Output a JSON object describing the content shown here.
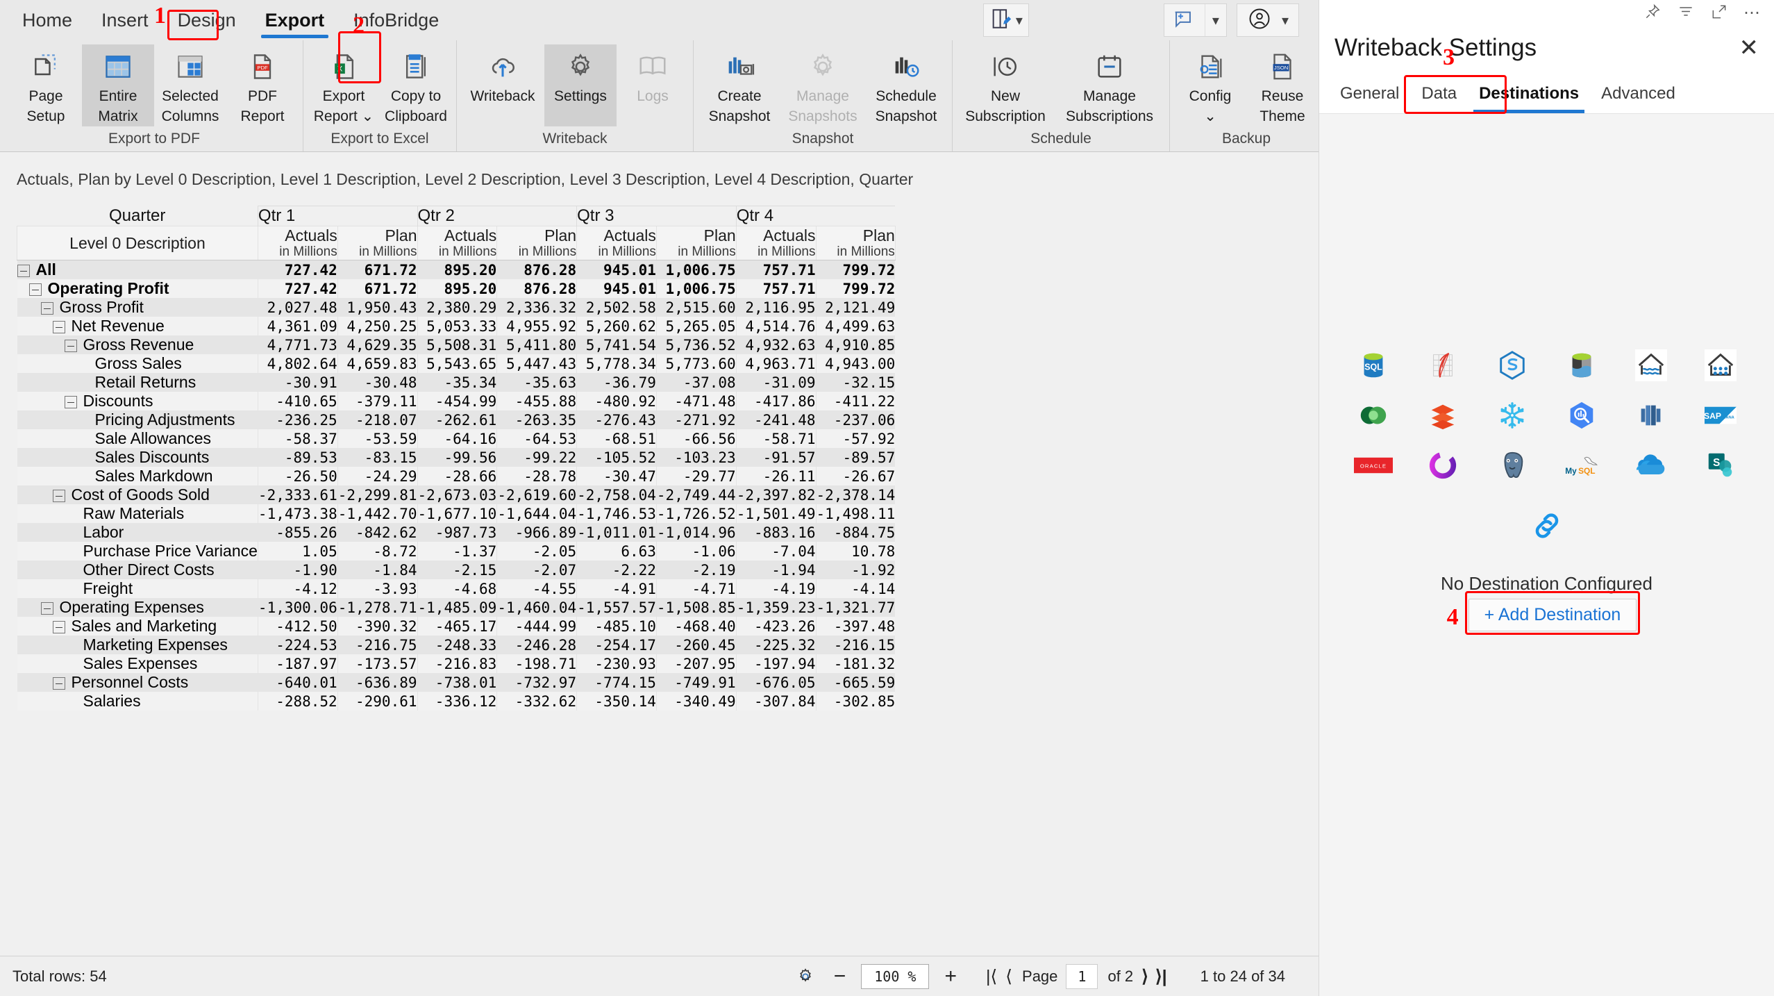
{
  "ribbon": {
    "tabs": [
      {
        "label": "Home",
        "active": false
      },
      {
        "label": "Insert",
        "active": false
      },
      {
        "label": "Design",
        "active": false
      },
      {
        "label": "Export",
        "active": true
      },
      {
        "label": "InfoBridge",
        "active": false
      }
    ],
    "groups": [
      {
        "label": "Export to PDF",
        "items": [
          {
            "label_1": "Page",
            "label_2": "Setup",
            "icon": "page-setup-icon",
            "state": "normal"
          },
          {
            "label_1": "Entire",
            "label_2": "Matrix",
            "icon": "entire-matrix-icon",
            "state": "selected"
          },
          {
            "label_1": "Selected",
            "label_2": "Columns",
            "icon": "selected-columns-icon",
            "state": "normal"
          },
          {
            "label_1": "PDF",
            "label_2": "Report",
            "icon": "pdf-report-icon",
            "state": "normal"
          }
        ]
      },
      {
        "label": "Export to Excel",
        "items": [
          {
            "label_1": "Export",
            "label_2": "Report ⌄",
            "icon": "excel-export-icon",
            "state": "normal"
          },
          {
            "label_1": "Copy to",
            "label_2": "Clipboard",
            "icon": "copy-clipboard-icon",
            "state": "normal"
          }
        ]
      },
      {
        "label": "Writeback",
        "items": [
          {
            "label_1": "Writeback",
            "label_2": "",
            "icon": "writeback-cloud-upload-icon",
            "state": "normal"
          },
          {
            "label_1": "Settings",
            "label_2": "",
            "icon": "gear-icon",
            "state": "selected"
          },
          {
            "label_1": "Logs",
            "label_2": "",
            "icon": "book-icon",
            "state": "disabled"
          }
        ]
      },
      {
        "label": "Snapshot",
        "items": [
          {
            "label_1": "Create",
            "label_2": "Snapshot",
            "icon": "create-snapshot-icon",
            "state": "normal"
          },
          {
            "label_1": "Manage",
            "label_2": "Snapshots",
            "icon": "gear-icon",
            "state": "disabled"
          },
          {
            "label_1": "Schedule",
            "label_2": "Snapshot",
            "icon": "schedule-snapshot-icon",
            "state": "normal"
          }
        ]
      },
      {
        "label": "Schedule",
        "items": [
          {
            "label_1": "New",
            "label_2": "Subscription",
            "icon": "clock-icon",
            "state": "normal"
          },
          {
            "label_1": "Manage",
            "label_2": "Subscriptions",
            "icon": "calendar-icon",
            "state": "normal"
          }
        ]
      },
      {
        "label": "Backup",
        "items": [
          {
            "label_1": "Config",
            "label_2": "⌄",
            "icon": "config-file-gear-icon",
            "state": "normal"
          },
          {
            "label_1": "Reuse",
            "label_2": "Theme",
            "icon": "json-file-icon",
            "state": "normal"
          }
        ]
      }
    ],
    "quick_buttons": [
      {
        "name": "edit-mode-icon",
        "has_caret": true
      },
      {
        "name": "add-comment-icon",
        "has_caret": true
      },
      {
        "name": "account-icon",
        "has_caret": true
      }
    ]
  },
  "annotations": [
    {
      "number": "1",
      "target": "export-tab"
    },
    {
      "number": "2",
      "target": "writeback-settings-button"
    },
    {
      "number": "3",
      "target": "destinations-tab"
    },
    {
      "number": "4",
      "target": "add-destination-button"
    }
  ],
  "report": {
    "subtitle": "Actuals, Plan by Level 0 Description, Level 1 Description, Level 2 Description, Level 3 Description, Level 4 Description, Quarter",
    "corner_label": "Quarter",
    "row_header_label": "Level 0 Description",
    "quarter_groups": [
      "Qtr 1",
      "Qtr 2",
      "Qtr 3",
      "Qtr 4"
    ],
    "measure_headers": [
      {
        "name": "Actuals",
        "unit": "in Millions"
      },
      {
        "name": "Plan",
        "unit": "in Millions"
      }
    ],
    "rows": [
      {
        "label": "All",
        "indent": 0,
        "toggle": true,
        "bold": true,
        "values": [
          "727.42",
          "671.72",
          "895.20",
          "876.28",
          "945.01",
          "1,006.75",
          "757.71",
          "799.72"
        ]
      },
      {
        "label": "Operating Profit",
        "indent": 1,
        "toggle": true,
        "bold": true,
        "values": [
          "727.42",
          "671.72",
          "895.20",
          "876.28",
          "945.01",
          "1,006.75",
          "757.71",
          "799.72"
        ]
      },
      {
        "label": "Gross Profit",
        "indent": 2,
        "toggle": true,
        "bold": false,
        "values": [
          "2,027.48",
          "1,950.43",
          "2,380.29",
          "2,336.32",
          "2,502.58",
          "2,515.60",
          "2,116.95",
          "2,121.49"
        ]
      },
      {
        "label": "Net Revenue",
        "indent": 3,
        "toggle": true,
        "bold": false,
        "values": [
          "4,361.09",
          "4,250.25",
          "5,053.33",
          "4,955.92",
          "5,260.62",
          "5,265.05",
          "4,514.76",
          "4,499.63"
        ]
      },
      {
        "label": "Gross Revenue",
        "indent": 4,
        "toggle": true,
        "bold": false,
        "values": [
          "4,771.73",
          "4,629.35",
          "5,508.31",
          "5,411.80",
          "5,741.54",
          "5,736.52",
          "4,932.63",
          "4,910.85"
        ]
      },
      {
        "label": "Gross Sales",
        "indent": 5,
        "toggle": false,
        "bold": false,
        "values": [
          "4,802.64",
          "4,659.83",
          "5,543.65",
          "5,447.43",
          "5,778.34",
          "5,773.60",
          "4,963.71",
          "4,943.00"
        ]
      },
      {
        "label": "Retail Returns",
        "indent": 5,
        "toggle": false,
        "bold": false,
        "values": [
          "-30.91",
          "-30.48",
          "-35.34",
          "-35.63",
          "-36.79",
          "-37.08",
          "-31.09",
          "-32.15"
        ]
      },
      {
        "label": "Discounts",
        "indent": 4,
        "toggle": true,
        "bold": false,
        "values": [
          "-410.65",
          "-379.11",
          "-454.99",
          "-455.88",
          "-480.92",
          "-471.48",
          "-417.86",
          "-411.22"
        ]
      },
      {
        "label": "Pricing Adjustments",
        "indent": 5,
        "toggle": false,
        "bold": false,
        "values": [
          "-236.25",
          "-218.07",
          "-262.61",
          "-263.35",
          "-276.43",
          "-271.92",
          "-241.48",
          "-237.06"
        ]
      },
      {
        "label": "Sale Allowances",
        "indent": 5,
        "toggle": false,
        "bold": false,
        "values": [
          "-58.37",
          "-53.59",
          "-64.16",
          "-64.53",
          "-68.51",
          "-66.56",
          "-58.71",
          "-57.92"
        ]
      },
      {
        "label": "Sales Discounts",
        "indent": 5,
        "toggle": false,
        "bold": false,
        "values": [
          "-89.53",
          "-83.15",
          "-99.56",
          "-99.22",
          "-105.52",
          "-103.23",
          "-91.57",
          "-89.57"
        ]
      },
      {
        "label": "Sales Markdown",
        "indent": 5,
        "toggle": false,
        "bold": false,
        "values": [
          "-26.50",
          "-24.29",
          "-28.66",
          "-28.78",
          "-30.47",
          "-29.77",
          "-26.11",
          "-26.67"
        ]
      },
      {
        "label": "Cost of Goods Sold",
        "indent": 3,
        "toggle": true,
        "bold": false,
        "values": [
          "-2,333.61",
          "-2,299.81",
          "-2,673.03",
          "-2,619.60",
          "-2,758.04",
          "-2,749.44",
          "-2,397.82",
          "-2,378.14"
        ]
      },
      {
        "label": "Raw Materials",
        "indent": 4,
        "toggle": false,
        "bold": false,
        "values": [
          "-1,473.38",
          "-1,442.70",
          "-1,677.10",
          "-1,644.04",
          "-1,746.53",
          "-1,726.52",
          "-1,501.49",
          "-1,498.11"
        ]
      },
      {
        "label": "Labor",
        "indent": 4,
        "toggle": false,
        "bold": false,
        "values": [
          "-855.26",
          "-842.62",
          "-987.73",
          "-966.89",
          "-1,011.01",
          "-1,014.96",
          "-883.16",
          "-884.75"
        ]
      },
      {
        "label": "Purchase Price Variance",
        "indent": 4,
        "toggle": false,
        "bold": false,
        "values": [
          "1.05",
          "-8.72",
          "-1.37",
          "-2.05",
          "6.63",
          "-1.06",
          "-7.04",
          "10.78"
        ]
      },
      {
        "label": "Other Direct Costs",
        "indent": 4,
        "toggle": false,
        "bold": false,
        "values": [
          "-1.90",
          "-1.84",
          "-2.15",
          "-2.07",
          "-2.22",
          "-2.19",
          "-1.94",
          "-1.92"
        ]
      },
      {
        "label": "Freight",
        "indent": 4,
        "toggle": false,
        "bold": false,
        "values": [
          "-4.12",
          "-3.93",
          "-4.68",
          "-4.55",
          "-4.91",
          "-4.71",
          "-4.19",
          "-4.14"
        ]
      },
      {
        "label": "Operating Expenses",
        "indent": 2,
        "toggle": true,
        "bold": false,
        "values": [
          "-1,300.06",
          "-1,278.71",
          "-1,485.09",
          "-1,460.04",
          "-1,557.57",
          "-1,508.85",
          "-1,359.23",
          "-1,321.77"
        ]
      },
      {
        "label": "Sales and Marketing",
        "indent": 3,
        "toggle": true,
        "bold": false,
        "values": [
          "-412.50",
          "-390.32",
          "-465.17",
          "-444.99",
          "-485.10",
          "-468.40",
          "-423.26",
          "-397.48"
        ]
      },
      {
        "label": "Marketing Expenses",
        "indent": 4,
        "toggle": false,
        "bold": false,
        "values": [
          "-224.53",
          "-216.75",
          "-248.33",
          "-246.28",
          "-254.17",
          "-260.45",
          "-225.32",
          "-216.15"
        ]
      },
      {
        "label": "Sales Expenses",
        "indent": 4,
        "toggle": false,
        "bold": false,
        "values": [
          "-187.97",
          "-173.57",
          "-216.83",
          "-198.71",
          "-230.93",
          "-207.95",
          "-197.94",
          "-181.32"
        ]
      },
      {
        "label": "Personnel Costs",
        "indent": 3,
        "toggle": true,
        "bold": false,
        "values": [
          "-640.01",
          "-636.89",
          "-738.01",
          "-732.97",
          "-774.15",
          "-749.91",
          "-676.05",
          "-665.59"
        ]
      },
      {
        "label": "Salaries",
        "indent": 4,
        "toggle": false,
        "bold": false,
        "values": [
          "-288.52",
          "-290.61",
          "-336.12",
          "-332.62",
          "-350.14",
          "-340.49",
          "-307.84",
          "-302.85"
        ]
      }
    ]
  },
  "status": {
    "total_rows": "Total rows: 54",
    "zoom": "100 %",
    "minus": "−",
    "plus": "+",
    "page_word": "Page",
    "page_value": "1",
    "of_pages": "of 2",
    "range": "1 to 24 of 34",
    "settings_icon": "gear-icon",
    "first_icon": "first-page-icon",
    "prev_icon": "previous-page-icon",
    "next_icon": "next-page-icon",
    "last_icon": "last-page-icon"
  },
  "panel": {
    "title": "Writeback Settings",
    "close_label": "✕",
    "tools": [
      "pin-icon",
      "filter-icon",
      "expand-icon",
      "more-icon"
    ],
    "tabs": [
      {
        "label": "General",
        "active": false
      },
      {
        "label": "Data",
        "active": false
      },
      {
        "label": "Destinations",
        "active": true
      },
      {
        "label": "Advanced",
        "active": false
      }
    ],
    "destination_logos": [
      {
        "name": "sql-server-logo",
        "text": "SQL"
      },
      {
        "name": "azure-sql-database-logo",
        "text": ""
      },
      {
        "name": "azure-synapse-logo",
        "text": ""
      },
      {
        "name": "azure-data-lake-logo",
        "text": ""
      },
      {
        "name": "fabric-lakehouse-logo",
        "text": ""
      },
      {
        "name": "fabric-warehouse-logo",
        "text": ""
      },
      {
        "name": "mongodb-logo",
        "text": ""
      },
      {
        "name": "databricks-logo",
        "text": ""
      },
      {
        "name": "snowflake-logo",
        "text": ""
      },
      {
        "name": "google-bigquery-logo",
        "text": ""
      },
      {
        "name": "amazon-redshift-logo",
        "text": ""
      },
      {
        "name": "sap-hana-logo",
        "text": "SAP"
      },
      {
        "name": "oracle-logo",
        "text": "ORACLE"
      },
      {
        "name": "azure-cosmos-db-logo",
        "text": ""
      },
      {
        "name": "postgresql-logo",
        "text": ""
      },
      {
        "name": "mysql-logo",
        "text": "MySQL"
      },
      {
        "name": "onedrive-logo",
        "text": ""
      },
      {
        "name": "sharepoint-logo",
        "text": "S"
      }
    ],
    "empty_state": {
      "icon": "link-icon",
      "message": "No Destination Configured",
      "add_button": "+ Add Destination"
    }
  }
}
